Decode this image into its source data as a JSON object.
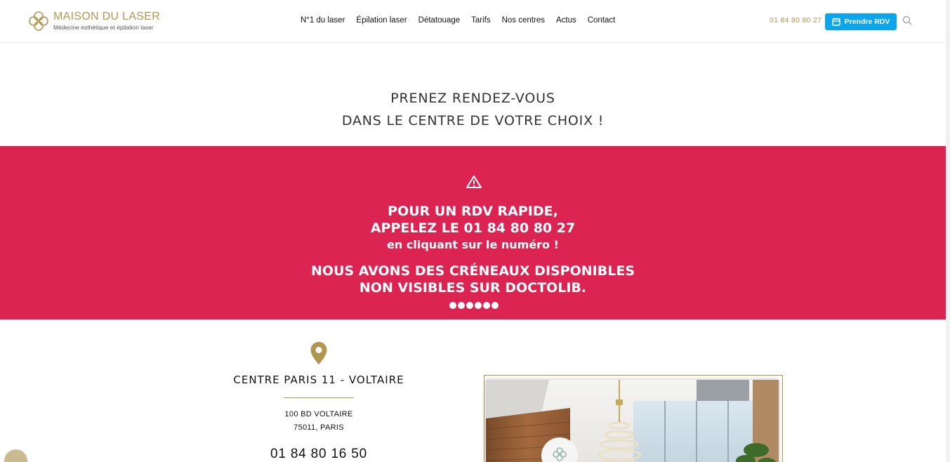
{
  "header": {
    "logo": {
      "title": "MAISON DU LASER",
      "subtitle": "Médecine esthétique et épilation laser"
    },
    "nav": [
      {
        "label": "N°1 du laser"
      },
      {
        "label": "Épilation laser"
      },
      {
        "label": "Détatouage"
      },
      {
        "label": "Tarifs"
      },
      {
        "label": "Nos centres"
      },
      {
        "label": "Actus"
      },
      {
        "label": "Contact"
      }
    ],
    "phone": "01 84 80 80 27",
    "cta_label": "Prendre RDV"
  },
  "intro": {
    "line1": "PRENEZ RENDEZ-VOUS",
    "line2": "DANS LE CENTRE DE VOTRE CHOIX !"
  },
  "banner": {
    "line1": "POUR UN RDV RAPIDE,",
    "line2": "APPELEZ LE 01 84 80 80 27",
    "line3": "en cliquant sur le numéro !",
    "line4": "NOUS AVONS DES CRÉNEAUX DISPONIBLES",
    "line5": "NON VISIBLES SUR DOCTOLIB.",
    "dot_count": 6
  },
  "centre": {
    "name": "CENTRE PARIS 11 - VOLTAIRE",
    "address_line1": "100 BD VOLTAIRE",
    "address_line2": "75011, PARIS",
    "phone": "01 84 80 16 50"
  },
  "colors": {
    "gold": "#b0974f",
    "banner_red": "#dc2452",
    "cta_blue": "#0ba5ec"
  },
  "icons": [
    "logo-icon",
    "calendar-icon",
    "search-icon",
    "warning-icon",
    "map-pin-icon"
  ]
}
